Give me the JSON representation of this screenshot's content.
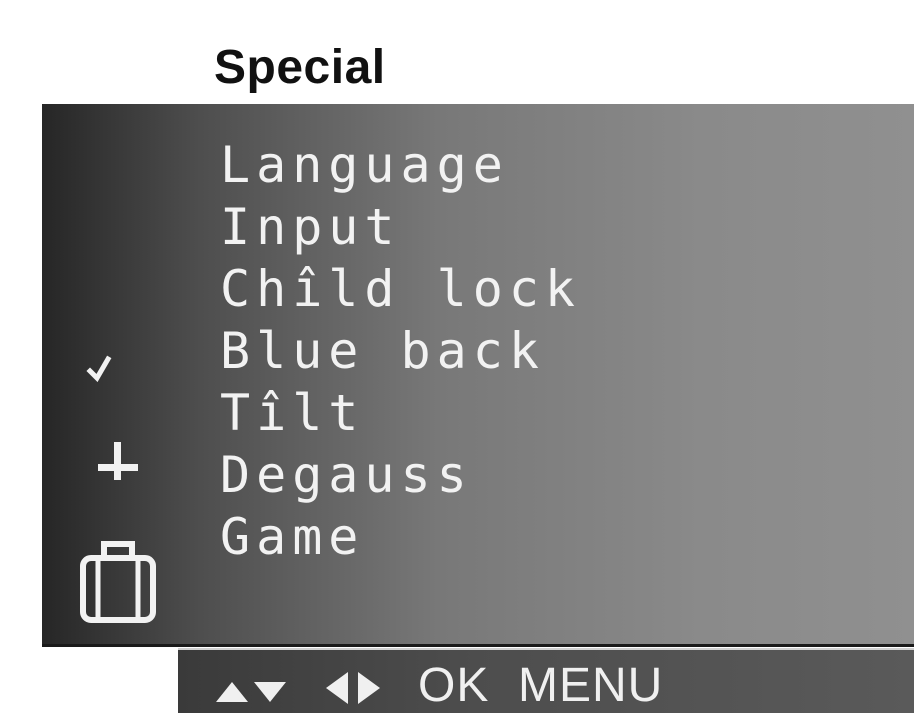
{
  "menu": {
    "title": "Special",
    "items": [
      {
        "label": "Language"
      },
      {
        "label": "Input"
      },
      {
        "label": "Chîld lock"
      },
      {
        "label": "Blue back"
      },
      {
        "label": "Tîlt"
      },
      {
        "label": "Degauss"
      },
      {
        "label": "Game"
      }
    ]
  },
  "side_icons": [
    "checkmark-icon",
    "adjust-icon",
    "lock-icon"
  ],
  "controls": {
    "updown_icon": "up-down-arrows-icon",
    "leftright_icon": "left-right-arrows-icon",
    "ok_label": "OK",
    "menu_label": "MENU"
  },
  "colors": {
    "panel_dark": "#262626",
    "panel_light": "#909090",
    "text": "#f2f2f2",
    "title": "#111111"
  }
}
